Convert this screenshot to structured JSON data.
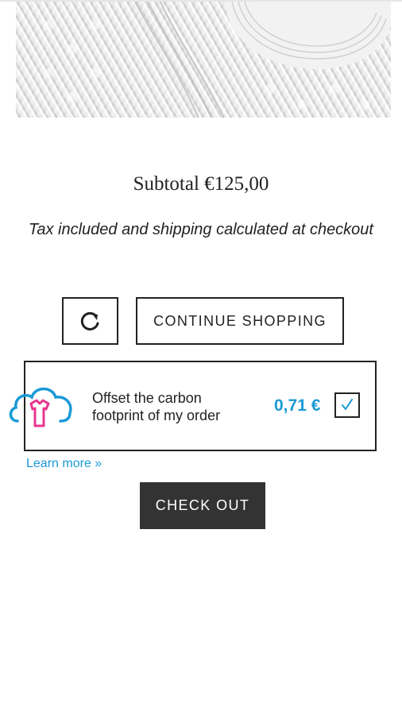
{
  "product": {
    "image_alt": "Knitted sweater close-up"
  },
  "cart": {
    "subtotal_label": "Subtotal €125,00",
    "tax_note": "Tax included and shipping calculated at checkout"
  },
  "actions": {
    "refresh_icon": "refresh-icon",
    "continue_label": "CONTINUE SHOPPING",
    "checkout_label": "CHECK OUT"
  },
  "carbon_offset": {
    "icon": "cloud-tshirt-icon",
    "text": "Offset the carbon footprint of my order",
    "price": "0,71 €",
    "checked": true,
    "learn_more": "Learn more »"
  },
  "colors": {
    "accent_blue": "#1a9ad6",
    "tshirt_pink": "#e8358f",
    "checkout_bg": "#333333"
  }
}
